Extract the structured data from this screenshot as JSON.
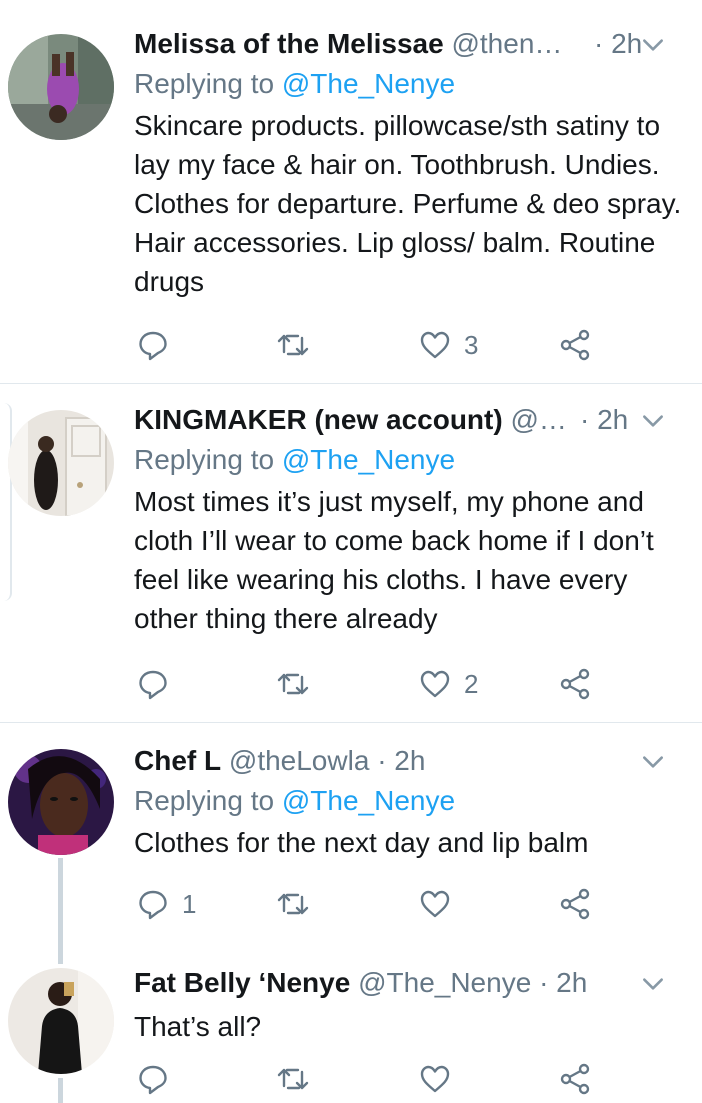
{
  "tweets": [
    {
      "name": "Melissa of the Melissae",
      "handle": "@then…",
      "time": "· 2h",
      "replying_prefix": "Replying to",
      "replying_to": "@The_Nenye",
      "text": "Skincare products. pillowcase/sth satiny to lay my face & hair on. Toothbrush. Undies. Clothes for departure. Perfume & deo spray. Hair accessories. Lip gloss/ balm. Routine drugs",
      "replies": "",
      "retweets": "",
      "likes": "3"
    },
    {
      "name": "KINGMAKER (new account)",
      "handle": "@…",
      "time": "· 2h",
      "replying_prefix": "Replying to",
      "replying_to": "@The_Nenye",
      "text": "Most times it’s just myself, my phone and cloth I’ll wear to come back home if I don’t feel like wearing his cloths. I have every other  thing there already",
      "replies": "",
      "retweets": "",
      "likes": "2"
    },
    {
      "name": "Chef L",
      "handle": "@theLowla",
      "time": "· 2h",
      "replying_prefix": "Replying to",
      "replying_to": "@The_Nenye",
      "text": "Clothes for the next day and lip balm",
      "replies": "1",
      "retweets": "",
      "likes": ""
    },
    {
      "name": "Fat Belly ‘Nenye",
      "handle": "@The_Nenye",
      "time": "· 2h",
      "text": "That’s all?",
      "replies": "",
      "retweets": "",
      "likes": ""
    }
  ],
  "colors": {
    "link": "#1da1f2",
    "muted": "#657786",
    "divider": "#e1e8ed",
    "thread_line": "#ccd6dd"
  },
  "icons": [
    "reply-icon",
    "retweet-icon",
    "like-icon",
    "share-icon",
    "chevron-down-icon"
  ]
}
